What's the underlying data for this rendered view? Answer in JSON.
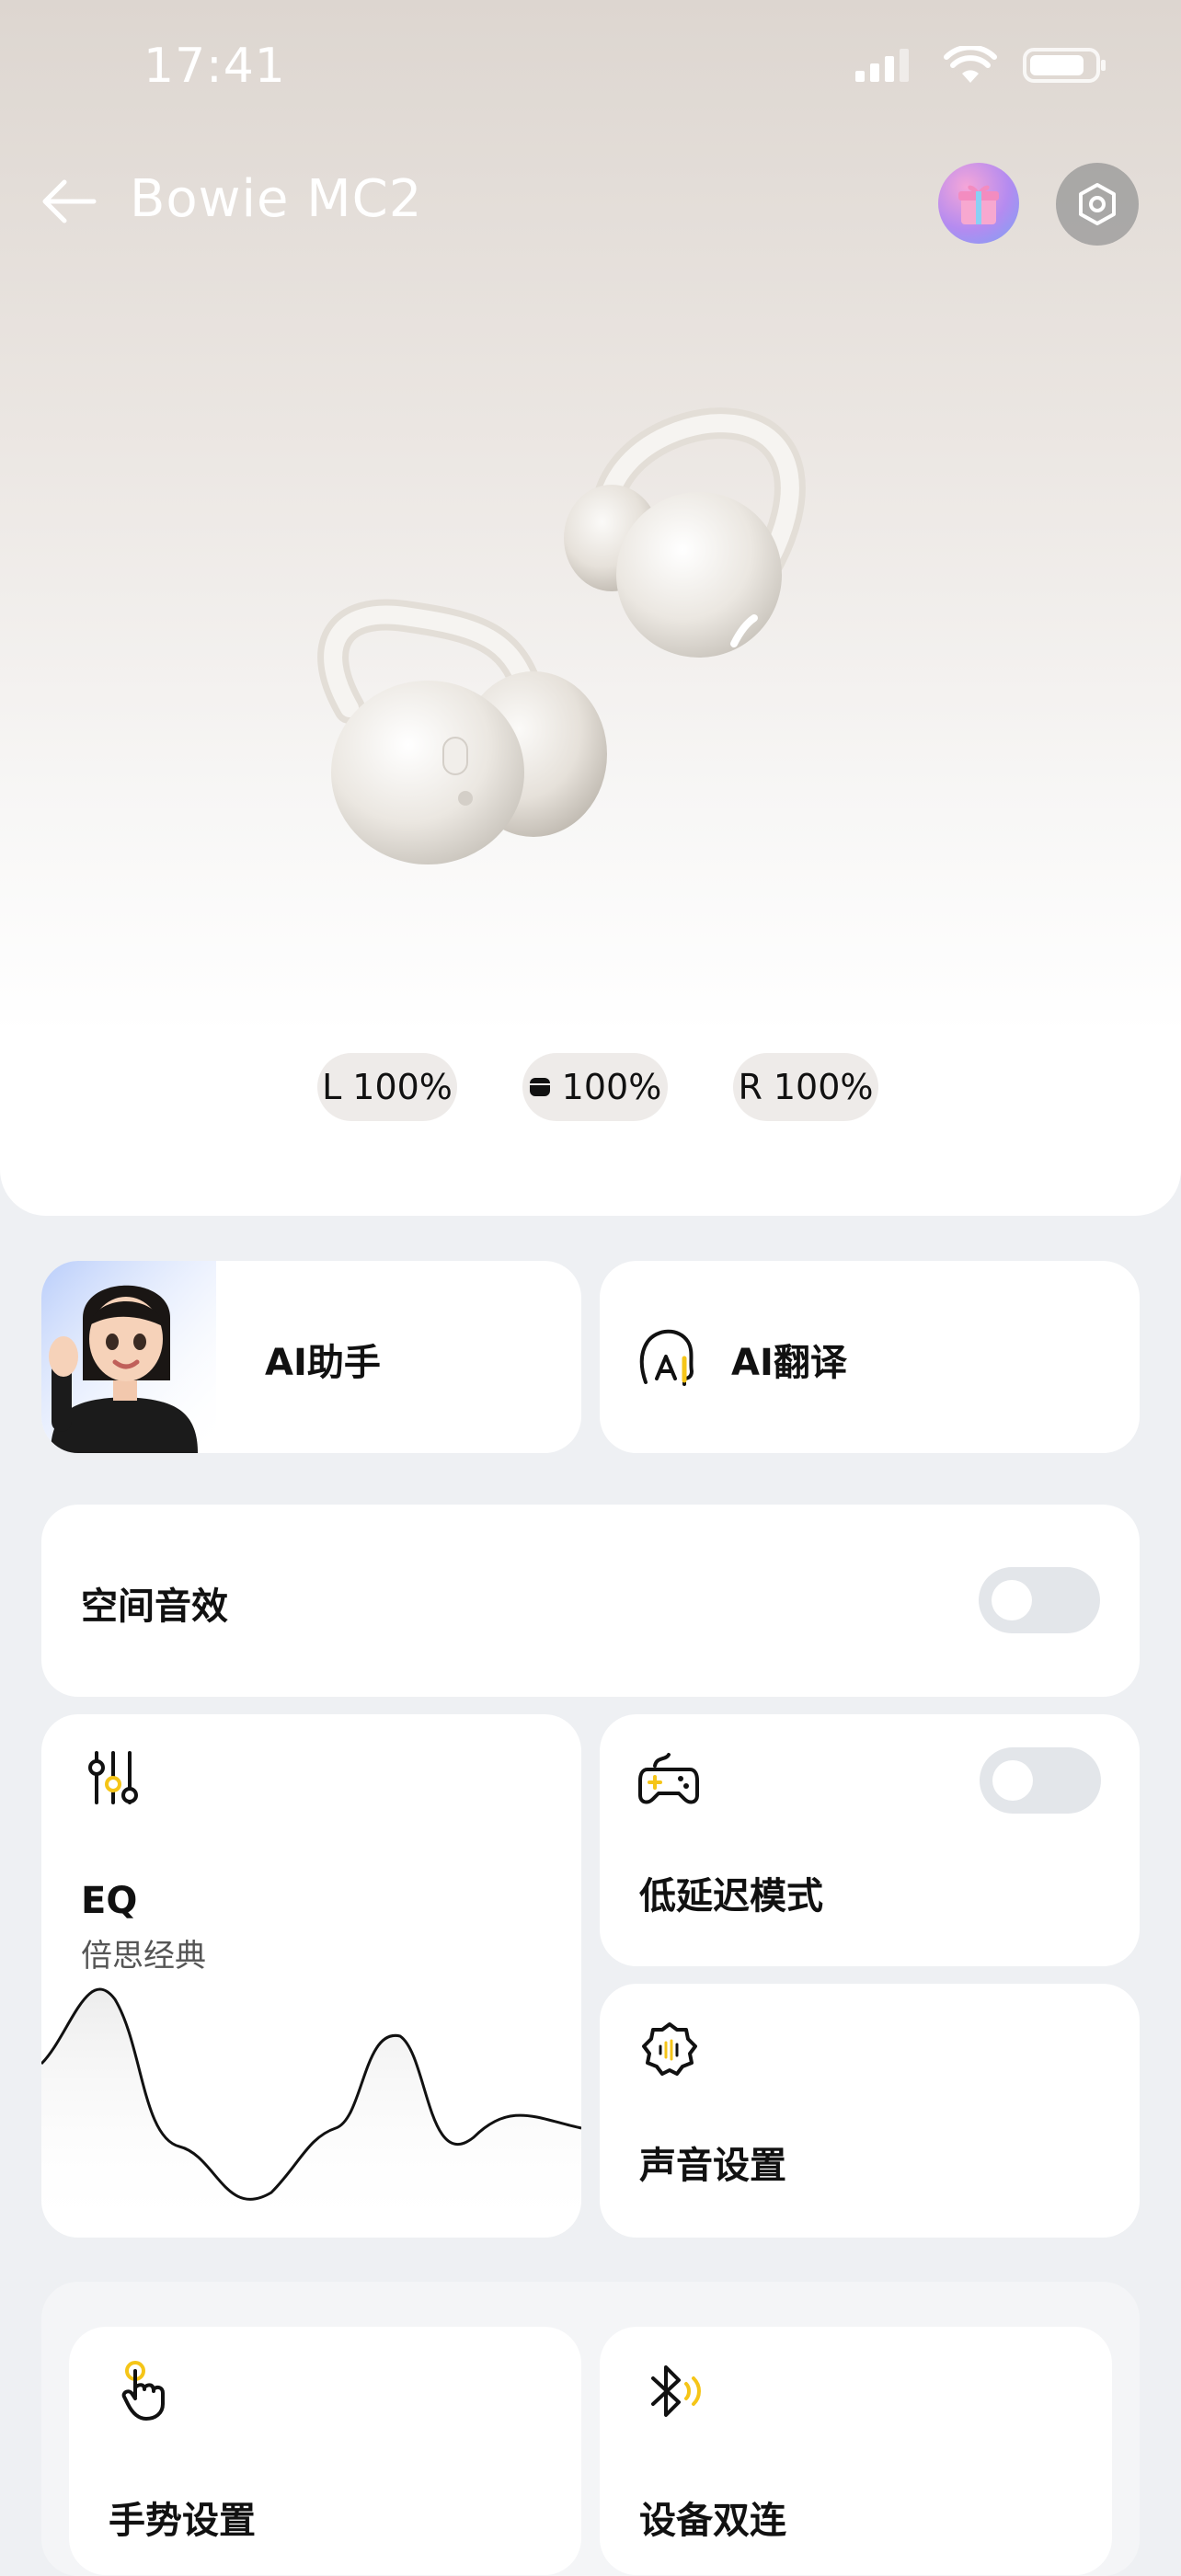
{
  "status_bar": {
    "time": "17:41"
  },
  "header": {
    "title": "Bowie MC2"
  },
  "battery": {
    "left_label": "L",
    "left_value": "100%",
    "case_value": "100%",
    "right_label": "R",
    "right_value": "100%"
  },
  "cards": {
    "ai_assistant": "AI助手",
    "ai_translate": "AI翻译",
    "spatial_audio": "空间音效",
    "eq_title": "EQ",
    "eq_preset": "倍思经典",
    "low_latency": "低延迟模式",
    "sound_settings": "声音设置",
    "gesture_settings": "手势设置",
    "dual_connection": "设备双连"
  },
  "colors": {
    "accent": "#f5c518",
    "toggle_off": "#e3e6ea"
  },
  "icons": [
    "back-arrow-icon",
    "gift-icon",
    "settings-hexagon-icon",
    "case-icon",
    "ai-head-icon",
    "eq-sliders-icon",
    "gamepad-icon",
    "sound-gear-icon",
    "gesture-hand-icon",
    "bluetooth-icon"
  ]
}
